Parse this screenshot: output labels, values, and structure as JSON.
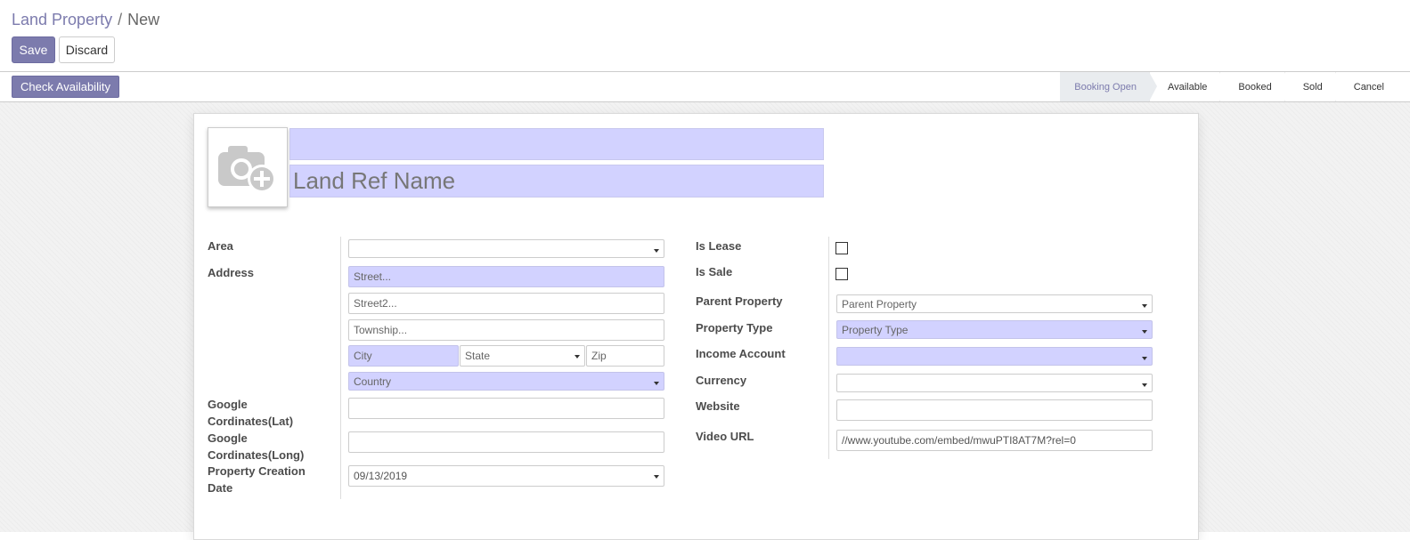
{
  "breadcrumb": {
    "parent": "Land Property",
    "separator": "/",
    "current": "New"
  },
  "buttons": {
    "save": "Save",
    "discard": "Discard",
    "check_availability": "Check Availability"
  },
  "stages": [
    {
      "label": "Booking Open",
      "active": true
    },
    {
      "label": "Available",
      "active": false
    },
    {
      "label": "Booked",
      "active": false
    },
    {
      "label": "Sold",
      "active": false
    },
    {
      "label": "Cancel",
      "active": false
    }
  ],
  "image": {
    "icon": "camera-plus-icon"
  },
  "title": {
    "name_value": "",
    "ref_placeholder": "Land Ref Name"
  },
  "left": {
    "area_label": "Area",
    "area_value": "",
    "address_label": "Address",
    "street_placeholder": "Street...",
    "street2_placeholder": "Street2...",
    "township_placeholder": "Township...",
    "city_placeholder": "City",
    "state_placeholder": "State",
    "zip_placeholder": "Zip",
    "country_placeholder": "Country",
    "lat_label_1": "Google",
    "lat_label_2": "Cordinates(Lat)",
    "long_label_1": "Google",
    "long_label_2": "Cordinates(Long)",
    "creation_label_1": "Property Creation",
    "creation_label_2": "Date",
    "creation_value": "09/13/2019"
  },
  "right": {
    "is_lease_label": "Is Lease",
    "is_lease_checked": false,
    "is_sale_label": "Is Sale",
    "is_sale_checked": false,
    "parent_label": "Parent Property",
    "parent_placeholder": "Parent Property",
    "type_label": "Property Type",
    "type_placeholder": "Property Type",
    "income_label": "Income Account",
    "income_value": "",
    "currency_label": "Currency",
    "currency_value": "",
    "website_label": "Website",
    "website_value": "",
    "video_label": "Video URL",
    "video_value": "//www.youtube.com/embed/mwuPTI8AT7M?rel=0"
  },
  "colors": {
    "primary": "#7c7bad",
    "required_bg": "#d2d2ff",
    "active_stage_bg": "#e9ecef"
  }
}
